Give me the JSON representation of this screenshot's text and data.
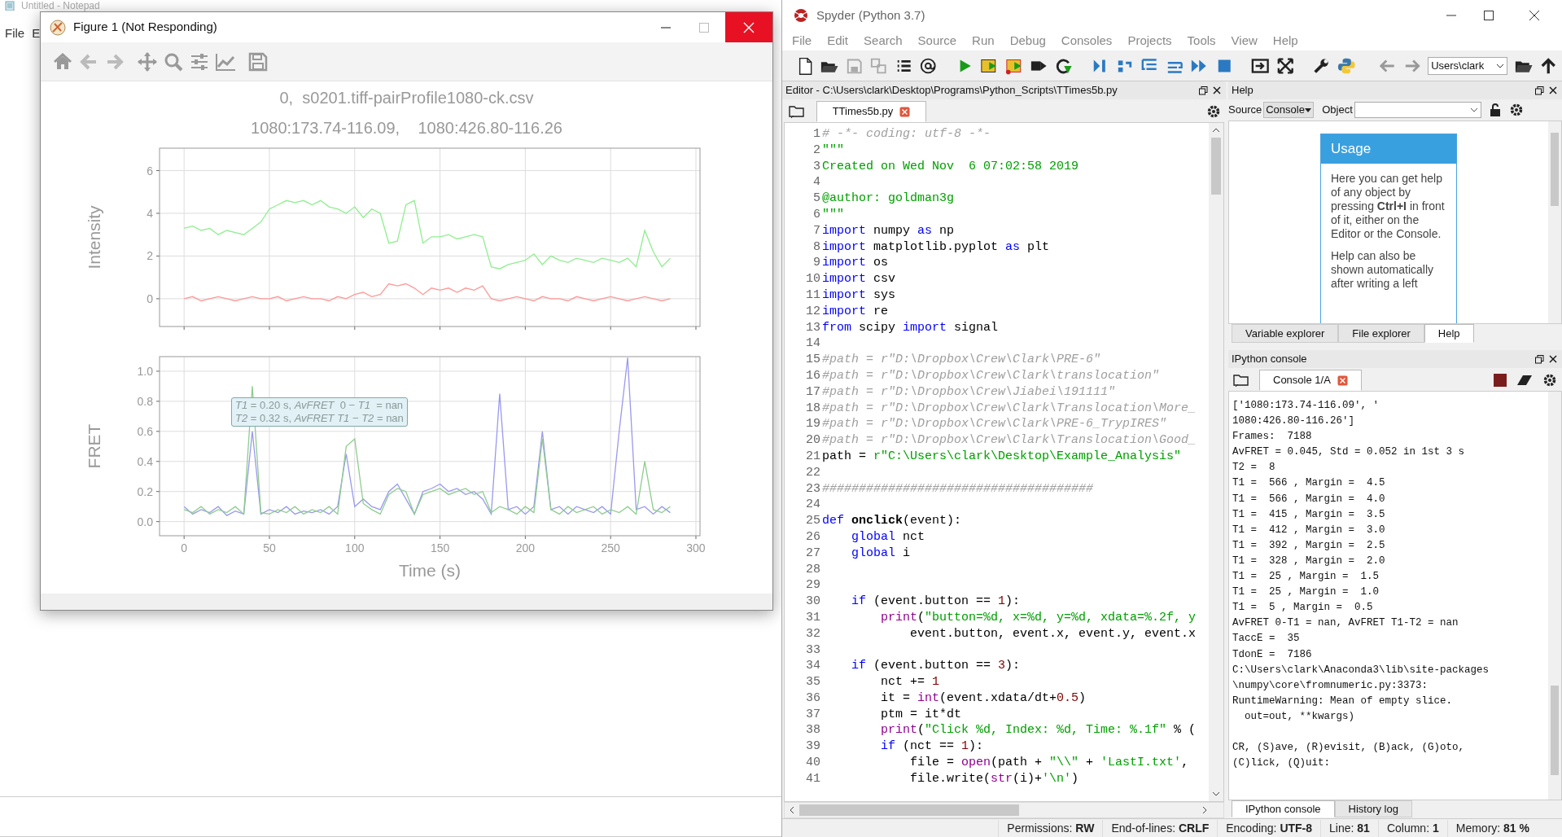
{
  "notepad": {
    "title": "Untitled - Notepad",
    "menu": [
      "File",
      "E"
    ]
  },
  "figure_window": {
    "title": "Figure 1 (Not Responding)",
    "suptitle": [
      "0,  s0201.tiff-pairProfile1080-ck.csv",
      "1080:173.74-116.09,    1080:426.80-116.26"
    ],
    "plots": [
      {
        "chart_data": {
          "type": "line",
          "ylabel": "Intensity",
          "x": [
            0,
            5,
            10,
            15,
            20,
            25,
            30,
            35,
            40,
            45,
            50,
            55,
            60,
            65,
            70,
            75,
            80,
            85,
            90,
            95,
            100,
            105,
            110,
            115,
            120,
            125,
            130,
            135,
            140,
            145,
            150,
            155,
            160,
            165,
            170,
            175,
            180,
            185,
            190,
            195,
            200,
            205,
            210,
            215,
            220,
            225,
            230,
            235,
            240,
            245,
            250,
            255,
            260,
            265,
            270,
            275,
            280,
            285
          ],
          "series": [
            {
              "color": "#90ee90",
              "values": [
                3.3,
                3.4,
                3.2,
                3.3,
                3.0,
                3.2,
                3.1,
                3.0,
                3.3,
                3.6,
                4.2,
                4.4,
                4.6,
                4.5,
                4.6,
                4.4,
                4.6,
                4.3,
                4.2,
                4.0,
                4.3,
                3.8,
                4.2,
                4.0,
                2.6,
                2.7,
                4.4,
                4.6,
                2.6,
                2.9,
                2.9,
                3.0,
                2.8,
                2.9,
                3.0,
                2.9,
                1.5,
                1.4,
                1.6,
                1.7,
                1.8,
                2.1,
                1.6,
                2.0,
                1.8,
                1.7,
                1.9,
                1.8,
                1.7,
                1.9,
                1.8,
                1.7,
                1.9,
                1.5,
                3.2,
                2.2,
                1.5,
                1.9
              ]
            },
            {
              "color": "#ff9999",
              "values": [
                0.0,
                0.1,
                -0.1,
                0.0,
                0.1,
                0.0,
                -0.1,
                0.0,
                0.1,
                0.0,
                0.0,
                0.1,
                -0.1,
                0.0,
                0.1,
                0.0,
                0.0,
                -0.1,
                0.1,
                0.0,
                0.2,
                0.3,
                0.1,
                0.2,
                0.7,
                0.6,
                0.7,
                0.5,
                0.2,
                0.5,
                0.4,
                0.5,
                0.3,
                0.5,
                0.4,
                0.6,
                0.0,
                -0.1,
                0.0,
                0.1,
                0.0,
                -0.1,
                0.1,
                0.0,
                0.0,
                -0.1,
                0.1,
                0.0,
                -0.1,
                0.0,
                0.1,
                0.0,
                -0.1,
                0.0,
                0.1,
                0.0,
                -0.1,
                0.0
              ]
            }
          ],
          "xlim": [
            -14.4,
            302.4
          ],
          "ylim": [
            -1.3,
            7.05
          ],
          "grid": true,
          "yticks": [
            {
              "value": 0,
              "label": "0"
            },
            {
              "value": 2,
              "label": "2"
            },
            {
              "value": 4,
              "label": "4"
            },
            {
              "value": 6,
              "label": "6"
            }
          ]
        }
      },
      {
        "chart_data": {
          "type": "line",
          "xlabel": "Time (s)",
          "ylabel": "FRET",
          "x": [
            0,
            5,
            10,
            15,
            20,
            25,
            30,
            35,
            40,
            45,
            50,
            55,
            60,
            65,
            70,
            75,
            80,
            85,
            90,
            95,
            100,
            105,
            110,
            115,
            120,
            125,
            130,
            135,
            140,
            145,
            150,
            155,
            160,
            165,
            170,
            175,
            180,
            185,
            190,
            195,
            200,
            205,
            210,
            215,
            220,
            225,
            230,
            235,
            240,
            245,
            250,
            255,
            260,
            265,
            270,
            275,
            280,
            285
          ],
          "series": [
            {
              "color": "#9999ee",
              "values": [
                0.1,
                0.05,
                0.08,
                0.06,
                0.1,
                0.04,
                0.07,
                0.05,
                0.6,
                0.05,
                0.08,
                0.06,
                0.1,
                0.05,
                0.07,
                0.06,
                0.08,
                0.05,
                0.1,
                0.45,
                0.1,
                0.15,
                0.1,
                0.08,
                0.2,
                0.25,
                0.15,
                0.05,
                0.2,
                0.22,
                0.25,
                0.2,
                0.22,
                0.18,
                0.2,
                0.15,
                0.05,
                0.85,
                0.08,
                0.1,
                0.05,
                0.1,
                0.6,
                0.08,
                0.1,
                0.05,
                0.1,
                0.08,
                0.06,
                0.1,
                0.05,
                0.6,
                1.09,
                0.08,
                0.1,
                0.05,
                0.1,
                0.06
              ]
            },
            {
              "color": "#8fcc8f",
              "values": [
                0.08,
                0.06,
                0.1,
                0.05,
                0.08,
                0.06,
                0.1,
                0.05,
                0.9,
                0.06,
                0.05,
                0.08,
                0.06,
                0.1,
                0.05,
                0.08,
                0.06,
                0.1,
                0.05,
                0.5,
                0.55,
                0.12,
                0.08,
                0.05,
                0.18,
                0.22,
                0.2,
                0.05,
                0.18,
                0.2,
                0.22,
                0.18,
                0.2,
                0.22,
                0.18,
                0.2,
                0.06,
                0.1,
                0.08,
                0.05,
                0.1,
                0.06,
                0.55,
                0.08,
                0.05,
                0.1,
                0.06,
                0.08,
                0.1,
                0.05,
                0.08,
                0.06,
                0.1,
                0.05,
                0.4,
                0.08,
                0.06,
                0.1
              ]
            }
          ],
          "xlim": [
            -14.4,
            302.4
          ],
          "ylim": [
            -0.094,
            1.097
          ],
          "grid": true,
          "xticks": [
            0,
            50,
            100,
            150,
            200,
            250,
            300
          ],
          "yticks": [
            {
              "value": 0,
              "label": "0.0"
            },
            {
              "value": 0.2,
              "label": "0.2"
            },
            {
              "value": 0.4,
              "label": "0.4"
            },
            {
              "value": 0.6,
              "label": "0.6"
            },
            {
              "value": 0.8,
              "label": "0.8"
            },
            {
              "value": 1.0,
              "label": "1.0"
            }
          ],
          "annotations": [
            {
              "text": "*T1* = 0.20 s, *AvFRET*  0 − *T1*  = nan\n*T2* = 0.32 s, *AvFRET* *T1* − *T2* = nan"
            }
          ]
        }
      }
    ]
  },
  "spyder": {
    "title": "Spyder (Python 3.7)",
    "menu": [
      "File",
      "Edit",
      "Search",
      "Source",
      "Run",
      "Debug",
      "Consoles",
      "Projects",
      "Tools",
      "View",
      "Help"
    ],
    "working_directory": "Users\\clark",
    "editor": {
      "title": "Editor - C:\\Users\\clark\\Desktop\\Programs\\Python_Scripts\\TTimes5b.py",
      "tabs": [
        {
          "label": "TTimes5b.py",
          "selected": true
        }
      ],
      "lines": [
        {
          "number": "1",
          "segments": [
            {
              "kind": "comment",
              "text": "# -*- coding: utf-8 -*-"
            }
          ]
        },
        {
          "number": "2",
          "segments": [
            {
              "kind": "string",
              "text": "\"\"\""
            }
          ]
        },
        {
          "number": "3",
          "segments": [
            {
              "kind": "string",
              "text": "Created on Wed Nov  6 07:02:58 2019"
            }
          ]
        },
        {
          "number": "4"
        },
        {
          "number": "5",
          "segments": [
            {
              "kind": "string",
              "text": "@author: goldman3g"
            }
          ]
        },
        {
          "number": "6",
          "segments": [
            {
              "kind": "string",
              "text": "\"\"\""
            }
          ]
        },
        {
          "number": "7",
          "segments": [
            {
              "kind": "keyword",
              "text": "import"
            },
            {
              "kind": "plain",
              "text": " numpy "
            },
            {
              "kind": "keyword",
              "text": "as"
            },
            {
              "kind": "plain",
              "text": " np"
            }
          ]
        },
        {
          "number": "8",
          "segments": [
            {
              "kind": "keyword",
              "text": "import"
            },
            {
              "kind": "plain",
              "text": " matplotlib.pyplot "
            },
            {
              "kind": "keyword",
              "text": "as"
            },
            {
              "kind": "plain",
              "text": " plt"
            }
          ]
        },
        {
          "number": "9",
          "segments": [
            {
              "kind": "keyword",
              "text": "import"
            },
            {
              "kind": "plain",
              "text": " os"
            }
          ]
        },
        {
          "number": "10",
          "segments": [
            {
              "kind": "keyword",
              "text": "import"
            },
            {
              "kind": "plain",
              "text": " csv"
            }
          ]
        },
        {
          "number": "11",
          "segments": [
            {
              "kind": "keyword",
              "text": "import"
            },
            {
              "kind": "plain",
              "text": " sys"
            }
          ]
        },
        {
          "number": "12",
          "segments": [
            {
              "kind": "keyword",
              "text": "import"
            },
            {
              "kind": "plain",
              "text": " re"
            }
          ]
        },
        {
          "number": "13",
          "segments": [
            {
              "kind": "keyword",
              "text": "from"
            },
            {
              "kind": "plain",
              "text": " scipy "
            },
            {
              "kind": "keyword",
              "text": "import"
            },
            {
              "kind": "plain",
              "text": " signal"
            }
          ]
        },
        {
          "number": "14"
        },
        {
          "number": "15",
          "segments": [
            {
              "kind": "comment",
              "text": "#path = r\"D:\\Dropbox\\Crew\\Clark\\PRE-6\""
            }
          ]
        },
        {
          "number": "16",
          "segments": [
            {
              "kind": "comment",
              "text": "#path = r\"D:\\Dropbox\\Crew\\Clark\\translocation\""
            }
          ]
        },
        {
          "number": "17",
          "segments": [
            {
              "kind": "comment",
              "text": "#path = r\"D:\\Dropbox\\Crew\\Jiabei\\191111\""
            }
          ]
        },
        {
          "number": "18",
          "segments": [
            {
              "kind": "comment",
              "text": "#path = r\"D:\\Dropbox\\Crew\\Clark\\Translocation\\More_"
            }
          ]
        },
        {
          "number": "19",
          "segments": [
            {
              "kind": "comment",
              "text": "#path = r\"D:\\Dropbox\\Crew\\Clark\\PRE-6_TrypIRES\""
            }
          ]
        },
        {
          "number": "20",
          "segments": [
            {
              "kind": "comment",
              "text": "#path = r\"D:\\Dropbox\\Crew\\Clark\\Translocation\\Good_"
            }
          ]
        },
        {
          "number": "21",
          "segments": [
            {
              "kind": "plain",
              "text": "path = "
            },
            {
              "kind": "string",
              "text": "r\"C:\\Users\\clark\\Desktop\\Example_Analysis\""
            }
          ]
        },
        {
          "number": "22"
        },
        {
          "number": "23",
          "segments": [
            {
              "kind": "comment",
              "text": "#####################################"
            }
          ]
        },
        {
          "number": "24"
        },
        {
          "number": "25",
          "segments": [
            {
              "kind": "keyword",
              "text": "def "
            },
            {
              "kind": "defname",
              "text": "onclick"
            },
            {
              "kind": "plain",
              "text": "(event):"
            }
          ]
        },
        {
          "number": "26",
          "segments": [
            {
              "kind": "keyword",
              "text": "    global"
            },
            {
              "kind": "plain",
              "text": " nct"
            }
          ]
        },
        {
          "number": "27",
          "segments": [
            {
              "kind": "keyword",
              "text": "    global"
            },
            {
              "kind": "plain",
              "text": " i"
            }
          ]
        },
        {
          "number": "28"
        },
        {
          "number": "29"
        },
        {
          "number": "30",
          "segments": [
            {
              "kind": "keyword",
              "text": "    if"
            },
            {
              "kind": "plain",
              "text": " (event.button == "
            },
            {
              "kind": "number",
              "text": "1"
            },
            {
              "kind": "plain",
              "text": "):"
            }
          ]
        },
        {
          "number": "31",
          "segments": [
            {
              "kind": "builtin",
              "text": "        print"
            },
            {
              "kind": "plain",
              "text": "("
            },
            {
              "kind": "string",
              "text": "\"button=%d, x=%d, y=%d, xdata=%.2f, y"
            }
          ]
        },
        {
          "number": "32",
          "segments": [
            {
              "kind": "plain",
              "text": "            event.button, event.x, event.y, event.x"
            }
          ]
        },
        {
          "number": "33"
        },
        {
          "number": "34",
          "segments": [
            {
              "kind": "keyword",
              "text": "    if"
            },
            {
              "kind": "plain",
              "text": " (event.button == "
            },
            {
              "kind": "number",
              "text": "3"
            },
            {
              "kind": "plain",
              "text": "):"
            }
          ]
        },
        {
          "number": "35",
          "segments": [
            {
              "kind": "plain",
              "text": "        nct += "
            },
            {
              "kind": "number",
              "text": "1"
            }
          ]
        },
        {
          "number": "36",
          "segments": [
            {
              "kind": "plain",
              "text": "        it = "
            },
            {
              "kind": "builtin",
              "text": "int"
            },
            {
              "kind": "plain",
              "text": "(event.xdata/dt+"
            },
            {
              "kind": "number",
              "text": "0.5"
            },
            {
              "kind": "plain",
              "text": ")"
            }
          ]
        },
        {
          "number": "37",
          "segments": [
            {
              "kind": "plain",
              "text": "        ptm = it*dt"
            }
          ]
        },
        {
          "number": "38",
          "segments": [
            {
              "kind": "builtin",
              "text": "        print"
            },
            {
              "kind": "plain",
              "text": "("
            },
            {
              "kind": "string",
              "text": "\"Click %d, Index: %d, Time: %.1f\""
            },
            {
              "kind": "plain",
              "text": " % ("
            }
          ]
        },
        {
          "number": "39",
          "segments": [
            {
              "kind": "keyword",
              "text": "        if"
            },
            {
              "kind": "plain",
              "text": " (nct == "
            },
            {
              "kind": "number",
              "text": "1"
            },
            {
              "kind": "plain",
              "text": "):"
            }
          ]
        },
        {
          "number": "40",
          "segments": [
            {
              "kind": "plain",
              "text": "            file = "
            },
            {
              "kind": "builtin",
              "text": "open"
            },
            {
              "kind": "plain",
              "text": "(path + "
            },
            {
              "kind": "string",
              "text": "\"\\\\\""
            },
            {
              "kind": "plain",
              "text": " + "
            },
            {
              "kind": "string",
              "text": "'LastI.txt'"
            },
            {
              "kind": "plain",
              "text": ","
            }
          ]
        },
        {
          "number": "41",
          "segments": [
            {
              "kind": "plain",
              "text": "            file.write("
            },
            {
              "kind": "builtin",
              "text": "str"
            },
            {
              "kind": "plain",
              "text": "(i)+"
            },
            {
              "kind": "string",
              "text": "'\\n'"
            },
            {
              "kind": "plain",
              "text": ")"
            }
          ]
        }
      ]
    },
    "help": {
      "title": "Help",
      "source_label": "Source",
      "source_value": "Console",
      "object_label": "Object",
      "usage_title": "Usage",
      "paragraphs": [
        "Here you can get help of any object by pressing **Ctrl+I** in front of it, either on the Editor or the Console.",
        "Help can also be shown automatically after writing a left"
      ],
      "tabs": [
        {
          "label": "Variable explorer",
          "selected": false
        },
        {
          "label": "File explorer",
          "selected": false
        },
        {
          "label": "Help",
          "selected": true
        }
      ]
    },
    "console": {
      "title": "IPython console",
      "tabs": [
        {
          "label": "Console 1/A",
          "selected": true
        }
      ],
      "output": [
        "['1080:173.74-116.09', '",
        "1080:426.80-116.26']",
        "Frames:  7188",
        "AvFRET = 0.045, Std = 0.052 in 1st 3 s",
        "T2 =  8",
        "T1 =  566 , Margin =  4.5",
        "T1 =  566 , Margin =  4.0",
        "T1 =  415 , Margin =  3.5",
        "T1 =  412 , Margin =  3.0",
        "T1 =  392 , Margin =  2.5",
        "T1 =  328 , Margin =  2.0",
        "T1 =  25 , Margin =  1.5",
        "T1 =  25 , Margin =  1.0",
        "T1 =  5 , Margin =  0.5",
        "AvFRET 0-T1 = nan, AvFRET T1-T2 = nan",
        "TaccE =  35",
        "TdonE =  7186",
        "C:\\Users\\clark\\Anaconda3\\lib\\site-packages",
        "\\numpy\\core\\fromnumeric.py:3373:",
        "RuntimeWarning: Mean of empty slice.",
        "  out=out, **kwargs)"
      ],
      "prompt": [
        "CR, (S)ave, (R)evisit, (B)ack, (G)oto,",
        "(C)lick, (Q)uit:"
      ],
      "bottom_tabs": [
        {
          "label": "IPython console",
          "selected": true
        },
        {
          "label": "History log",
          "selected": false
        }
      ]
    },
    "status_bar": [
      "Permissions: **RW**",
      "End-of-lines: **CRLF**",
      "Encoding: **UTF-8**",
      "Line: **81**",
      "Column: **1**",
      "Memory: **81 %**"
    ]
  }
}
